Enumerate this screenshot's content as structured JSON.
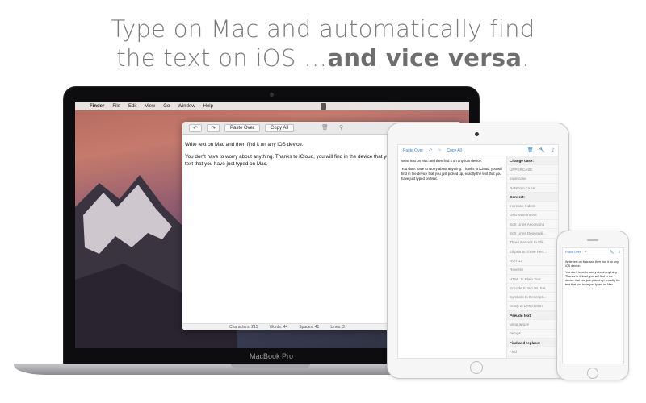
{
  "headline": {
    "line1": "Type on Mac and automatically find",
    "line2_prefix": "the text on iOS …",
    "line2_bold": "and vice versa",
    "line2_suffix": "."
  },
  "mac": {
    "label": "MacBook Pro",
    "menubar": {
      "app": "Finder",
      "items": [
        "File",
        "Edit",
        "View",
        "Go",
        "Window",
        "Help"
      ]
    },
    "toolbar": {
      "undo_icon": "undo-icon",
      "redo_icon": "redo-icon",
      "paste_over": "Paste Over",
      "copy_all": "Copy All"
    },
    "text": {
      "p1": "Write text on Mac and then find it on any iOS device.",
      "p2": "You don't have to worry about anything. Thanks to iCloud, you will find in the device that you just picked up, exactly the text that you have just typed on Mac."
    },
    "status": {
      "characters": "Characters: 215",
      "words": "Words: 44",
      "spaces": "Spaces: 41",
      "lines": "Lines: 3"
    }
  },
  "ipad": {
    "toolbar": {
      "paste_over": "Paste Over",
      "copy_all": "Copy All"
    },
    "text": {
      "p1": "Write text on Mac and then find it on any iOS device.",
      "p2": "You don't have to worry about anything. Thanks to iCloud, you will find in the device that you just picked up, exactly the text that you have just typed on Mac."
    },
    "sidebar": [
      {
        "label": "Change case:",
        "head": true
      },
      {
        "label": "UPPERCASE",
        "head": false
      },
      {
        "label": "lowercase",
        "head": false
      },
      {
        "label": "RaNDom cASe",
        "head": false
      },
      {
        "label": "Convert:",
        "head": true
      },
      {
        "label": "Increase Indent",
        "head": false
      },
      {
        "label": "Decrease Indent",
        "head": false
      },
      {
        "label": "Sort Lines Ascending",
        "head": false
      },
      {
        "label": "Sort Lines Descendi...",
        "head": false
      },
      {
        "label": "Three Periods to Elli...",
        "head": false
      },
      {
        "label": "Ellipsis to Three Peri...",
        "head": false
      },
      {
        "label": "ROT 13",
        "head": false
      },
      {
        "label": "Reverse",
        "head": false
      },
      {
        "label": "HTML to Plain Text",
        "head": false
      },
      {
        "label": "Encode to % URL Set",
        "head": false
      },
      {
        "label": "Symbols to Descripti...",
        "head": false
      },
      {
        "label": "Emoji to Description",
        "head": false
      },
      {
        "label": "Pseudo text:",
        "head": true
      },
      {
        "label": "uɐop ǝpoɔɐ",
        "head": false
      },
      {
        "label": "bɐɔʞM",
        "head": false
      },
      {
        "label": "Find and replace:",
        "head": true
      },
      {
        "label": "Find",
        "head": false
      },
      {
        "label": "Replace",
        "head": false
      },
      {
        "label": "Regular Expressions",
        "head": false
      }
    ]
  },
  "iphone": {
    "toolbar": {
      "paste_over": "Paste Over"
    },
    "text": {
      "p1": "Write text on Mac and then find it on any iOS device.",
      "p2": "You don't have to worry about anything. Thanks to iCloud, you will find in the device that you just picked up, exactly the text that you have just typed on Mac."
    }
  }
}
